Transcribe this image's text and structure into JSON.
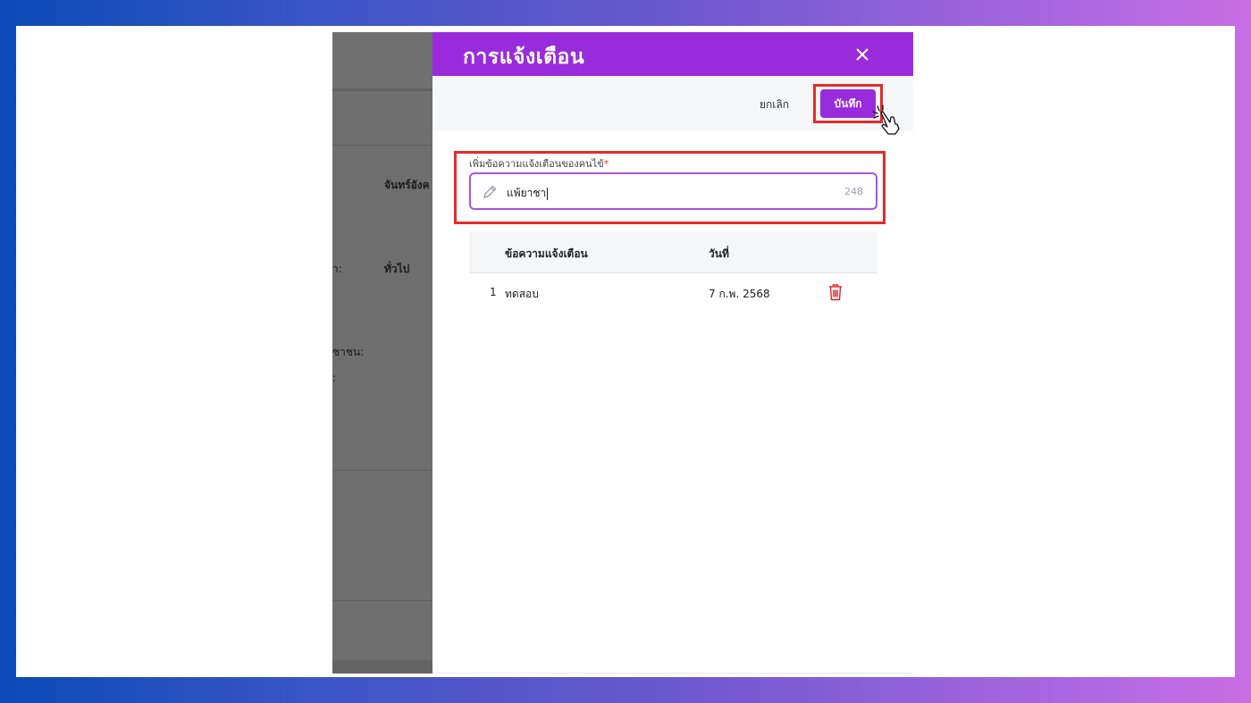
{
  "background_page": {
    "labels": [
      "จันทร์อังค",
      "ำ:",
      "ทั่วไป",
      "ชาชน:",
      ":"
    ]
  },
  "drawer": {
    "title": "การแจ้งเตือน",
    "close_icon": "close-icon",
    "toolbar": {
      "cancel_label": "ยกเลิก",
      "save_label": "บันทึก"
    },
    "field": {
      "label": "เพิ่มข้อความแจ้งเตือนของคนไข้",
      "required_mark": "*",
      "value": "แพ้ยาชา",
      "remaining_count": "248",
      "icon": "pencil-icon"
    },
    "table": {
      "columns": [
        "ข้อความแจ้งเตือน",
        "วันที่"
      ],
      "rows": [
        {
          "index": "1",
          "message": "ทดสอบ",
          "date": "7 ก.พ. 2568",
          "action_icon": "trash-icon"
        }
      ]
    }
  },
  "colors": {
    "accent": "#9a2bdc",
    "highlight": "#e62a2a",
    "delete": "#e02424"
  }
}
